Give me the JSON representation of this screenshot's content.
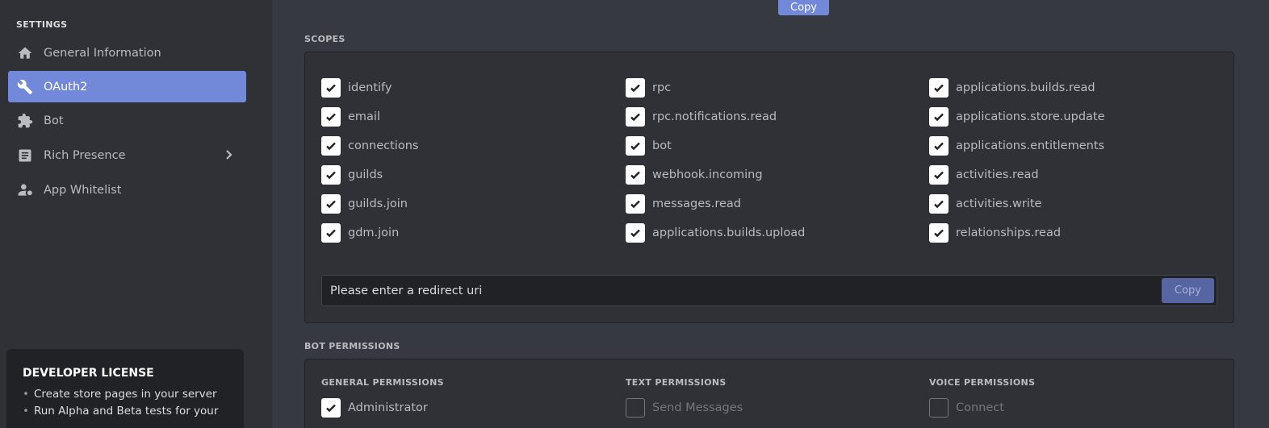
{
  "sidebar": {
    "heading": "SETTINGS",
    "items": [
      {
        "label": "General Information",
        "icon": "home-icon"
      },
      {
        "label": "OAuth2",
        "icon": "wrench-icon",
        "active": true
      },
      {
        "label": "Bot",
        "icon": "puzzle-icon"
      },
      {
        "label": "Rich Presence",
        "icon": "document-icon",
        "has_submenu": true
      },
      {
        "label": "App Whitelist",
        "icon": "person-icon"
      }
    ],
    "license": {
      "title": "DEVELOPER LICENSE",
      "bullets": [
        "Create store pages in your server",
        "Run Alpha and Beta tests for your"
      ]
    }
  },
  "top_copy_label": "Copy",
  "scopes": {
    "title": "SCOPES",
    "columns": [
      [
        "identify",
        "email",
        "connections",
        "guilds",
        "guilds.join",
        "gdm.join"
      ],
      [
        "rpc",
        "rpc.notifications.read",
        "bot",
        "webhook.incoming",
        "messages.read",
        "applications.builds.upload"
      ],
      [
        "applications.builds.read",
        "applications.store.update",
        "applications.entitlements",
        "activities.read",
        "activities.write",
        "relationships.read"
      ]
    ],
    "redirect_placeholder": "Please enter a redirect uri",
    "copy_label": "Copy"
  },
  "bot_permissions": {
    "title": "BOT PERMISSIONS",
    "groups": [
      {
        "heading": "GENERAL PERMISSIONS",
        "first": "Administrator",
        "checked": true
      },
      {
        "heading": "TEXT PERMISSIONS",
        "first": "Send Messages",
        "checked": false
      },
      {
        "heading": "VOICE PERMISSIONS",
        "first": "Connect",
        "checked": false
      }
    ]
  },
  "colors": {
    "accent": "#7289da",
    "sidebar_bg": "#2f3136",
    "main_bg": "#36393f",
    "panel_bg": "#2f3136"
  }
}
